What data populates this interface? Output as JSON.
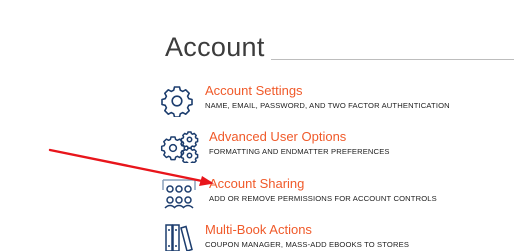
{
  "page": {
    "title": "Account"
  },
  "items": [
    {
      "icon": "gear-icon",
      "label": "Account Settings",
      "description": "NAME, EMAIL, PASSWORD, AND TWO FACTOR AUTHENTICATION"
    },
    {
      "icon": "gears-icon",
      "label": "Advanced User Options",
      "description": "FORMATTING AND ENDMATTER PREFERENCES"
    },
    {
      "icon": "users-icon",
      "label": "Account Sharing",
      "description": "ADD OR REMOVE PERMISSIONS FOR ACCOUNT CONTROLS"
    },
    {
      "icon": "books-icon",
      "label": "Multi-Book Actions",
      "description": "COUPON MANAGER, MASS-ADD EBOOKS TO STORES"
    }
  ],
  "colors": {
    "accent": "#f05a2a",
    "icon": "#1c3d6e",
    "annotation_arrow": "#e8151b"
  }
}
